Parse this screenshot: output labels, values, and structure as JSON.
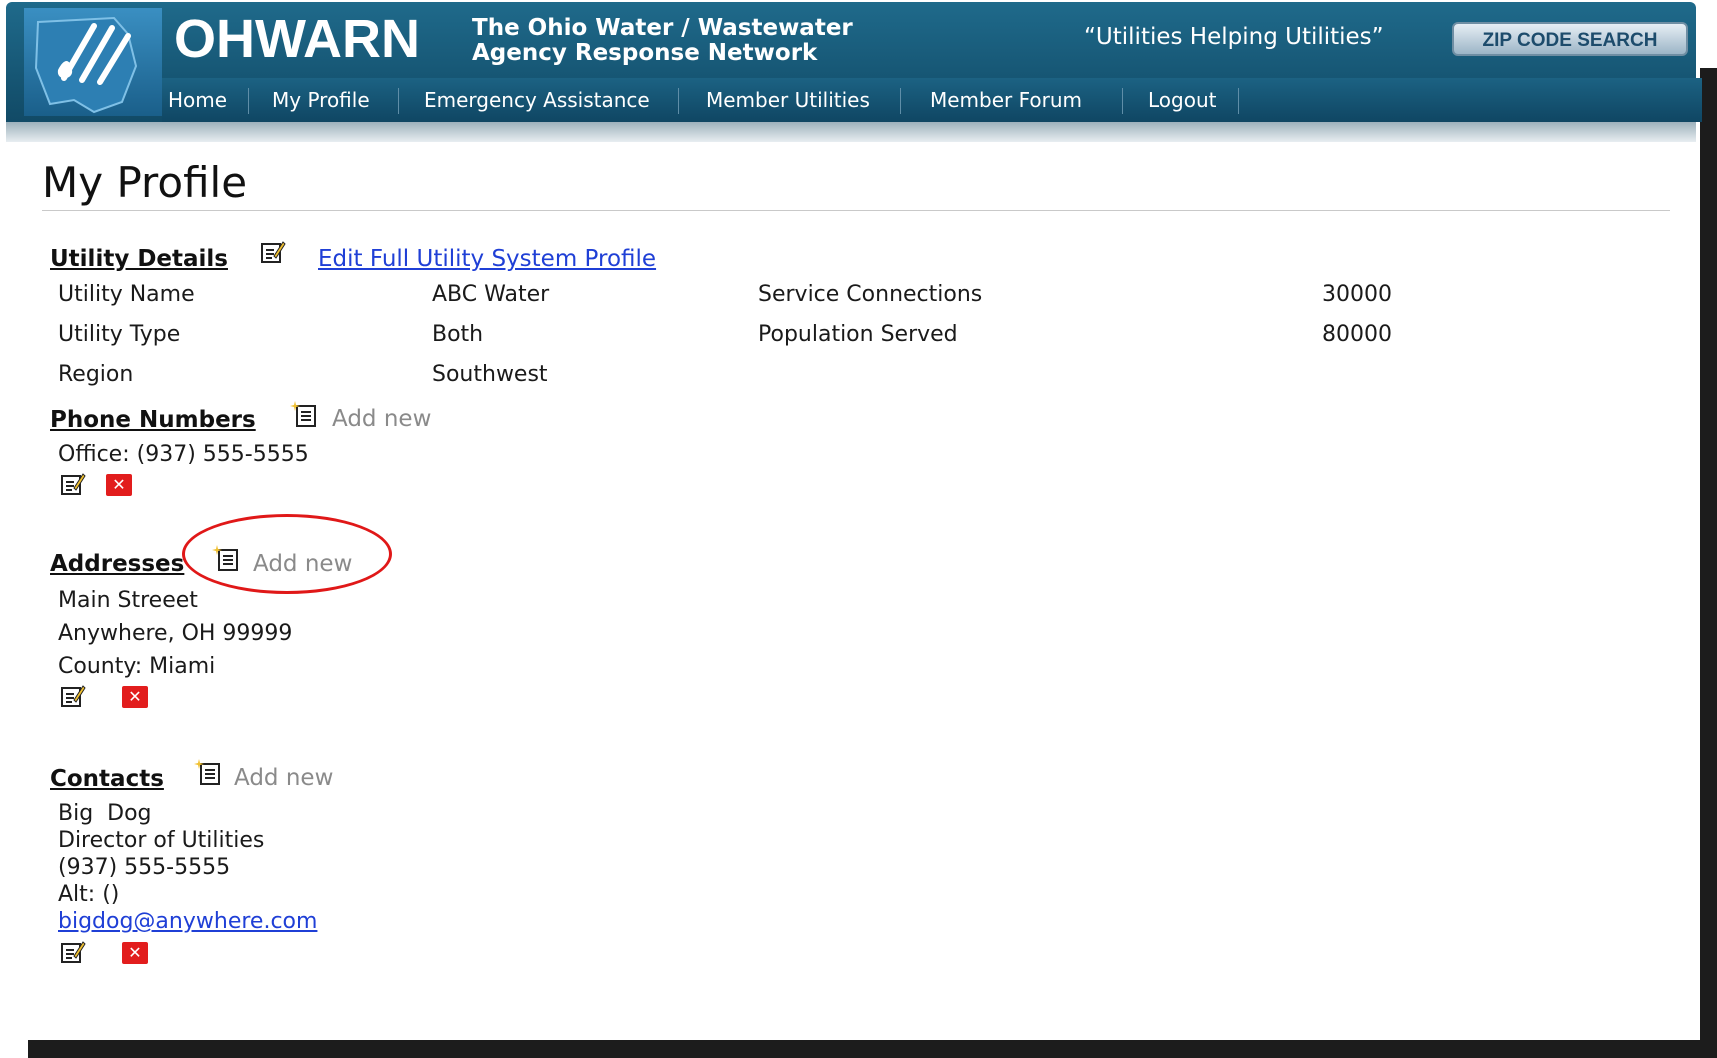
{
  "header": {
    "brand": "OHWARN",
    "tagline_line1": "The Ohio Water / Wastewater",
    "tagline_line2": "Agency Response Network",
    "motto": "“Utilities Helping Utilities”",
    "zip_search_label": "ZIP CODE SEARCH"
  },
  "nav": {
    "items": [
      "Home",
      "My Profile",
      "Emergency Assistance",
      "Member Utilities",
      "Member Forum",
      "Logout"
    ]
  },
  "page": {
    "title": "My Profile"
  },
  "utility_details": {
    "heading": "Utility Details",
    "edit_link": "Edit Full Utility System Profile",
    "rows": [
      {
        "label": "Utility Name",
        "value": "ABC Water"
      },
      {
        "label": "Utility Type",
        "value": "Both"
      },
      {
        "label": "Region",
        "value": "Southwest"
      }
    ],
    "stats": [
      {
        "label": "Service Connections",
        "value": "30000"
      },
      {
        "label": "Population Served",
        "value": "80000"
      }
    ]
  },
  "phone_numbers": {
    "heading": "Phone Numbers",
    "add_label": "Add new",
    "entries": [
      "Office: (937) 555-5555"
    ]
  },
  "addresses": {
    "heading": "Addresses",
    "add_label": "Add new",
    "lines": [
      "Main Streeet",
      "Anywhere, OH 99999",
      "County: Miami"
    ]
  },
  "contacts": {
    "heading": "Contacts",
    "add_label": "Add new",
    "name": "Big  Dog",
    "role": "Director of Utilities",
    "phone": "(937) 555-5555",
    "alt": "Alt: ()",
    "email": "bigdog@anywhere.com"
  },
  "icons": {
    "edit": "edit-note-icon",
    "add": "add-note-icon",
    "delete": "delete-x-icon"
  },
  "colors": {
    "header": "#1f6a8b",
    "link": "#1f3fd6",
    "delete": "#e21d1d",
    "highlight": "#e01818"
  }
}
